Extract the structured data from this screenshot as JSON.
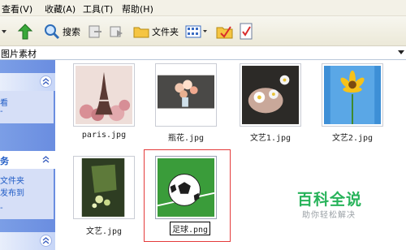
{
  "menu": {
    "items": [
      "查看(V)",
      "收藏(A)",
      "工具(T)",
      "帮助(H)"
    ]
  },
  "toolbar": {
    "search_label": "搜索",
    "folders_label": "文件夹"
  },
  "address": {
    "value": "图片素材"
  },
  "taskpane": {
    "panel1_line1": "看",
    "panel1_line2": "-",
    "panel2_title": "务",
    "panel2_line1": "文件夹",
    "panel2_line2": "发布到",
    "panel2_line3": "-"
  },
  "files": [
    {
      "name": "paris.jpg"
    },
    {
      "name": "瓶花.jpg"
    },
    {
      "name": "文艺1.jpg"
    },
    {
      "name": "文艺2.jpg"
    },
    {
      "name": "文艺.jpg"
    },
    {
      "name": "足球.png"
    }
  ],
  "watermark": {
    "main": "百科全说",
    "sub": "助你轻松解决"
  },
  "colors": {
    "taskpane_link": "#215dc6",
    "selection_border": "#e43a3a",
    "watermark": "#27b35a"
  }
}
